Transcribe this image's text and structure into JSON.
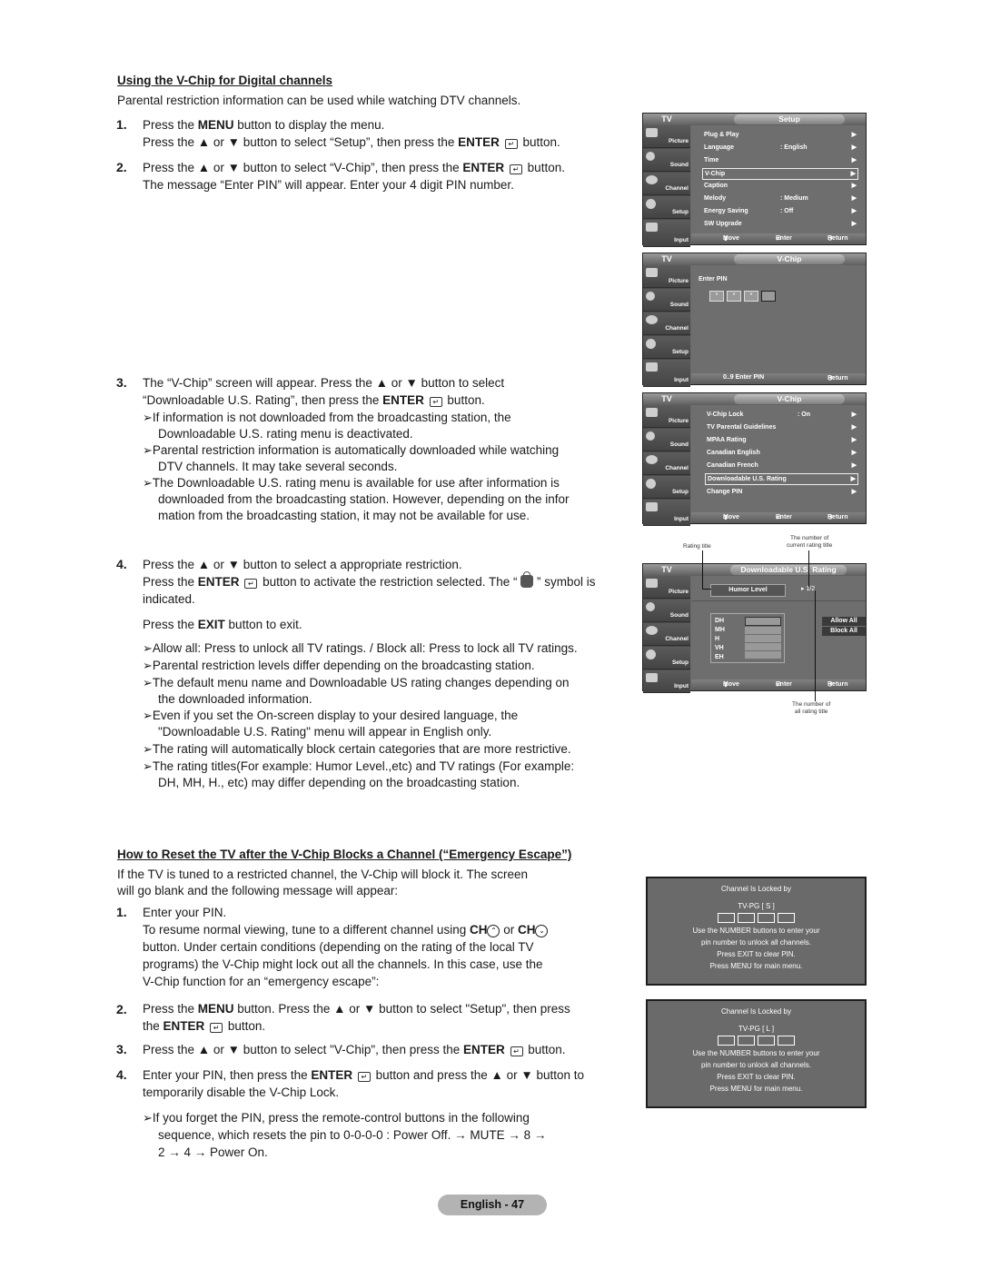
{
  "section1": {
    "heading": "Using the V-Chip for Digital channels",
    "intro": "Parental restriction information can be used while watching DTV channels.",
    "steps": [
      {
        "num": "1.",
        "lines": [
          "Press the MENU button to display the menu.",
          "Press the ▲ or ▼ button to select “Setup”, then press the ENTER button."
        ]
      },
      {
        "num": "2.",
        "lines": [
          "Press the ▲ or ▼ button to select “V-Chip”, then press the ENTER button.",
          "The message “Enter PIN” will appear. Enter your 4 digit PIN number."
        ]
      },
      {
        "num": "3.",
        "lines": [
          "The “V-Chip” screen will appear. Press the ▲ or ▼ button to select",
          "“Downloadable U.S. Rating”, then press the ENTER button."
        ],
        "notes": [
          [
            "If information is not downloaded from the broadcasting station, the",
            "Downloadable U.S. rating menu is deactivated."
          ],
          [
            "Parental restriction information is automatically downloaded while watching",
            "DTV channels. It may take several seconds."
          ],
          [
            "The Downloadable U.S. rating menu is available for use after information is",
            "downloaded from the broadcasting station. However, depending on the infor",
            "mation from the broadcasting station, it may not be available for use."
          ]
        ]
      },
      {
        "num": "4.",
        "lines": [
          "Press the ▲ or ▼ button to select a appropriate restriction.",
          "Press the ENTER button to activate the restriction selected. The “ ” symbol is",
          "indicated."
        ],
        "exit_line": "Press the EXIT button to exit.",
        "notes": [
          [
            "Allow all: Press to unlock all TV ratings. / Block all: Press to lock all TV ratings."
          ],
          [
            "Parental restriction levels differ depending on the broadcasting station."
          ],
          [
            "The default menu name and Downloadable US rating changes depending on",
            "the downloaded information."
          ],
          [
            "Even if you set the On-screen display to your desired language, the",
            "\"Downloadable U.S. Rating\" menu will appear in English only."
          ],
          [
            "The rating will automatically block certain categories that are more restrictive."
          ],
          [
            "The rating titles(For example: Humor Level.,etc) and TV ratings (For example:",
            "DH, MH, H., etc) may differ depending on the broadcasting station."
          ]
        ]
      }
    ]
  },
  "section2": {
    "heading": "How to Reset the TV after the V-Chip Blocks a Channel (“Emergency Escape”)",
    "intro": [
      "If the TV is tuned to a restricted channel, the V-Chip will block it. The screen",
      "will go blank and the following message will appear:"
    ],
    "steps": [
      {
        "num": "1.",
        "lines": [
          "Enter your PIN.",
          "To resume normal viewing, tune to a different channel using CH or CH",
          "button. Under certain conditions (depending on the rating of the local TV",
          "programs) the V-Chip might lock out all the channels. In this case, use the",
          "V-Chip function for an “emergency escape”:"
        ]
      },
      {
        "num": "2.",
        "lines": [
          "Press the MENU button. Press the ▲ or ▼ button to select \"Setup\", then press",
          "the ENTER button."
        ]
      },
      {
        "num": "3.",
        "lines": [
          "Press the ▲ or ▼ button to select \"V-Chip\", then press the ENTER button."
        ]
      },
      {
        "num": "4.",
        "lines": [
          "Enter your PIN, then press the ENTER button and press the ▲ or ▼ button to",
          "temporarily disable the V-Chip Lock."
        ]
      }
    ],
    "note": [
      "If you forget the PIN, press the remote-control buttons in the following",
      "sequence, which resets the pin to 0-0-0-0 : Power Off. → MUTE → 8 →",
      "2 → 4 → Power On."
    ]
  },
  "tv_common": {
    "tv_label": "TV",
    "side_items": [
      "Picture",
      "Sound",
      "Channel",
      "Setup",
      "Input"
    ],
    "move": "Move",
    "enter": "Enter",
    "return": "Return"
  },
  "screen_setup": {
    "title": "Setup",
    "items": [
      {
        "label": "Plug & Play",
        "value": ""
      },
      {
        "label": "Language",
        "value": ": English"
      },
      {
        "label": "Time",
        "value": ""
      },
      {
        "label": "V-Chip",
        "value": "",
        "selected": true
      },
      {
        "label": "Caption",
        "value": ""
      },
      {
        "label": "Melody",
        "value": ": Medium"
      },
      {
        "label": "Energy Saving",
        "value": ": Off"
      },
      {
        "label": "SW Upgrade",
        "value": ""
      }
    ]
  },
  "screen_pin": {
    "title": "V-Chip",
    "prompt": "Enter PIN",
    "pin_digits": [
      "*",
      "*",
      "*",
      ""
    ],
    "foot_hint": "0..9 Enter PIN"
  },
  "screen_vchip": {
    "title": "V-Chip",
    "items": [
      {
        "label": "V-Chip Lock",
        "value": ": On"
      },
      {
        "label": "TV Parental Guidelines",
        "value": ""
      },
      {
        "label": "MPAA Rating",
        "value": ""
      },
      {
        "label": "Canadian English",
        "value": ""
      },
      {
        "label": "Canadian French",
        "value": ""
      },
      {
        "label": "Downloadable U.S. Rating",
        "value": "",
        "selected": true
      },
      {
        "label": "Change PIN",
        "value": ""
      }
    ]
  },
  "screen_download": {
    "title": "Downloadable U.S. Rating",
    "rating_title": "Humor Level",
    "page": "1/2",
    "ratings": [
      "DH",
      "MH",
      "H",
      "VH",
      "EH"
    ],
    "allow_all": "Allow All",
    "block_all": "Block All",
    "annotations": {
      "rating_title": "Rating title",
      "current": [
        "The number of",
        "current rating title"
      ],
      "all": [
        "The number of",
        "all rating title"
      ]
    }
  },
  "lock_messages": [
    {
      "title": "Channel Is Locked by",
      "rating": "TV-PG [ S ]",
      "lines": [
        "Use the NUMBER buttons to enter your",
        "pin number to unlock all channels.",
        "Press EXIT to clear PIN.",
        "Press MENU for main menu."
      ]
    },
    {
      "title": "Channel Is Locked by",
      "rating": "TV-PG [ L ]",
      "lines": [
        "Use the NUMBER buttons to enter your",
        "pin number to unlock all channels.",
        "Press EXIT to clear PIN.",
        "Press MENU for main menu."
      ]
    }
  ],
  "footer": {
    "page_label": "English - 47"
  }
}
